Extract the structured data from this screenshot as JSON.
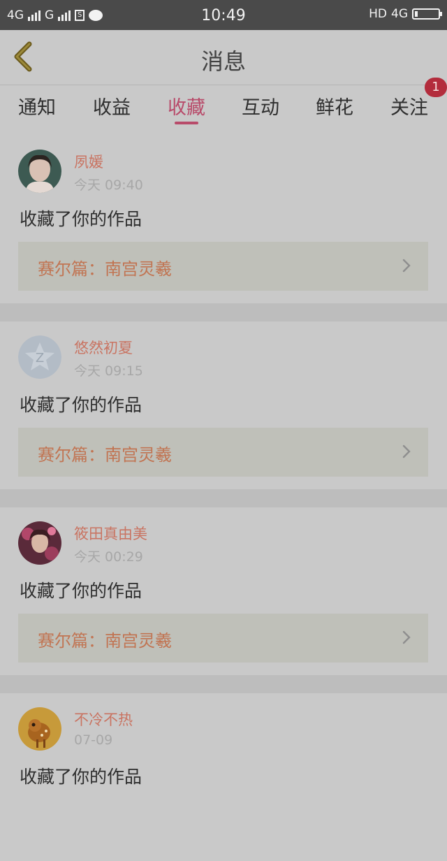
{
  "status_bar": {
    "left_network_1": "4G",
    "left_network_2": "G",
    "sim_label": "S",
    "time": "10:49",
    "right_hd": "HD",
    "right_network": "4G"
  },
  "header": {
    "title": "消息",
    "back_icon": "chevron-left-icon"
  },
  "tabs": [
    {
      "label": "通知"
    },
    {
      "label": "收益"
    },
    {
      "label": "收藏"
    },
    {
      "label": "互动"
    },
    {
      "label": "鲜花"
    },
    {
      "label": "关注"
    }
  ],
  "active_tab_index": 2,
  "follow_badge": "1",
  "messages": [
    {
      "name": "夙媛",
      "time": "今天 09:40",
      "action": "收藏了你的作品",
      "work": "赛尔篇：南宫灵羲"
    },
    {
      "name": "悠然初夏",
      "time": "今天 09:15",
      "action": "收藏了你的作品",
      "work": "赛尔篇：南宫灵羲"
    },
    {
      "name": "筱田真由美",
      "time": "今天 00:29",
      "action": "收藏了你的作品",
      "work": "赛尔篇：南宫灵羲"
    },
    {
      "name": "不冷不热",
      "time": "07-09",
      "action": "收藏了你的作品",
      "work": ""
    }
  ],
  "colors": {
    "accent": "#b84b6a",
    "name": "#c97462",
    "badge": "#b32c3c"
  }
}
